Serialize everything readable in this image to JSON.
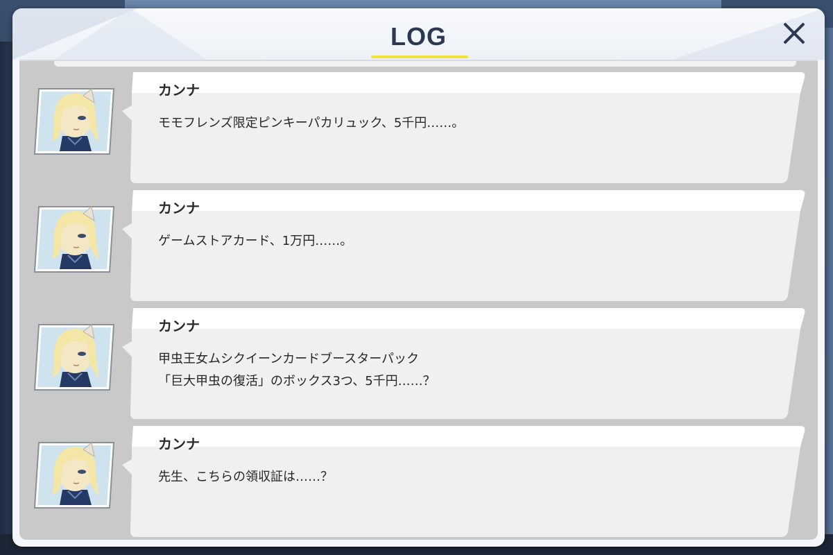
{
  "log_panel": {
    "title": "LOG",
    "close_icon": "close-x-icon",
    "title_underline_color": "#f2e33a"
  },
  "entries": [
    {
      "avatar": "kanna-portrait",
      "speaker": "カンナ",
      "text": "モモフレンズ限定ピンキーパカリュック、5千円……。"
    },
    {
      "avatar": "kanna-portrait",
      "speaker": "カンナ",
      "text": "ゲームストアカード、1万円……。"
    },
    {
      "avatar": "kanna-portrait",
      "speaker": "カンナ",
      "text": "甲虫王女ムシクイーンカードブースターパック\n「巨大甲虫の復活」のボックス3つ、5千円……？"
    },
    {
      "avatar": "kanna-portrait",
      "speaker": "カンナ",
      "text": "先生、こちらの領収証は……？"
    }
  ]
}
